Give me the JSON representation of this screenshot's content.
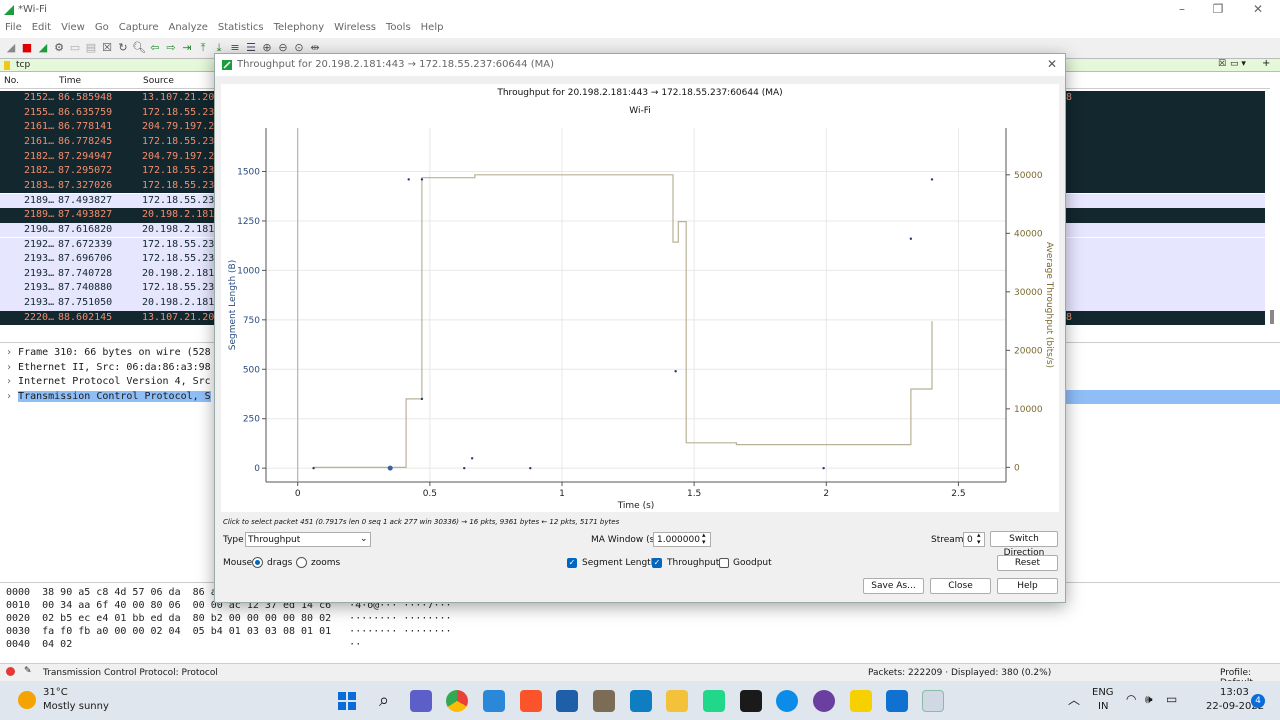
{
  "app": {
    "title": "*Wi-Fi"
  },
  "menu": [
    "File",
    "Edit",
    "View",
    "Go",
    "Capture",
    "Analyze",
    "Statistics",
    "Telephony",
    "Wireless",
    "Tools",
    "Help"
  ],
  "filter": {
    "value": "tcp"
  },
  "packet_list": {
    "headers": {
      "no": "No.",
      "time": "Time",
      "source": "Source"
    },
    "rows": [
      {
        "no": "2152…",
        "time": "86.585948",
        "source": "13.107.21.20",
        "style": "dark"
      },
      {
        "no": "2155…",
        "time": "86.635759",
        "source": "172.18.55.23",
        "style": "dark"
      },
      {
        "no": "2161…",
        "time": "86.778141",
        "source": "204.79.197.2",
        "style": "dark"
      },
      {
        "no": "2161…",
        "time": "86.778245",
        "source": "172.18.55.23",
        "style": "dark"
      },
      {
        "no": "2182…",
        "time": "87.294947",
        "source": "204.79.197.2",
        "style": "dark"
      },
      {
        "no": "2182…",
        "time": "87.295072",
        "source": "172.18.55.23",
        "style": "dark"
      },
      {
        "no": "2183…",
        "time": "87.327026",
        "source": "172.18.55.23",
        "style": "dark"
      },
      {
        "no": "2189…",
        "time": "87.493827",
        "source": "172.18.55.23",
        "style": "light"
      },
      {
        "no": "2189…",
        "time": "87.493827",
        "source": "20.198.2.181",
        "style": "dark"
      },
      {
        "no": "2190…",
        "time": "87.616820",
        "source": "20.198.2.181",
        "style": "light"
      },
      {
        "no": "2192…",
        "time": "87.672339",
        "source": "172.18.55.23",
        "style": "light"
      },
      {
        "no": "2193…",
        "time": "87.696706",
        "source": "172.18.55.23",
        "style": "light"
      },
      {
        "no": "2193…",
        "time": "87.740728",
        "source": "20.198.2.181",
        "style": "light"
      },
      {
        "no": "2193…",
        "time": "87.740880",
        "source": "172.18.55.23",
        "style": "light"
      },
      {
        "no": "2193…",
        "time": "87.751050",
        "source": "20.198.2.181",
        "style": "light"
      },
      {
        "no": "2220…",
        "time": "88.602145",
        "source": "13.107.21.20",
        "style": "dark"
      }
    ],
    "right_marks": [
      "8",
      "8"
    ]
  },
  "details": [
    "Frame 310: 66 bytes on wire (528",
    "Ethernet II, Src: 06:da:86:a3:98",
    "Internet Protocol Version 4, Src",
    "Transmission Control Protocol, S"
  ],
  "hex": [
    "0000  38 90 a5 c8 4d 57 06 da  86 a",
    "0010  00 34 aa 6f 40 00 80 06  00 00 ac 12 37 ed 14 c6   ·4·o@··· ····7···",
    "0020  02 b5 ec e4 01 bb ed da  80 b2 00 00 00 00 80 02   ········ ········",
    "0030  fa f0 fb a0 00 00 02 04  05 b4 01 03 03 08 01 01   ········ ········",
    "0040  04 02                                              ··"
  ],
  "status": {
    "left": "Transmission Control Protocol: Protocol",
    "packets": "Packets: 222209 · Displayed: 380 (0.2%)",
    "profile": "Profile: Default"
  },
  "dialog": {
    "window_title": "Throughput for 20.198.2.181:443 → 172.18.55.237:60644 (MA)",
    "click_hint": "Click to select packet 451 (0.7917s len 0 seq 1 ack 277 win 30336) → 16 pkts, 9361 bytes ← 12 pkts, 5171 bytes",
    "type_label": "Type",
    "type_value": "Throughput",
    "ma_label": "MA Window (s)",
    "ma_value": "1.000000",
    "stream_label": "Stream",
    "stream_value": "0",
    "switch_direction": "Switch Direction",
    "mouse_label": "Mouse",
    "drags": "drags",
    "zooms": "zooms",
    "seg_len": "Segment Length",
    "throughput": "Throughput",
    "goodput": "Goodput",
    "reset": "Reset",
    "save_as": "Save As...",
    "close": "Close",
    "help": "Help"
  },
  "chart_data": {
    "type": "scatter",
    "title": "Throughput for 20.198.2.181:443 → 172.18.55.237:60644 (MA)",
    "subtitle": "Wi-Fi",
    "xlabel": "Time (s)",
    "ylabel": "Segment Length (B)",
    "y2label": "Average Throughput (bits/s)",
    "xlim": [
      -0.12,
      2.68
    ],
    "ylim": [
      -70,
      1720
    ],
    "y2lim": [
      -2500,
      58000
    ],
    "xticks": [
      0,
      0.5,
      1,
      1.5,
      2,
      2.5
    ],
    "yticks": [
      0,
      250,
      500,
      750,
      1000,
      1250,
      1500
    ],
    "y2ticks": [
      0,
      10000,
      20000,
      30000,
      40000,
      50000
    ],
    "grid": true,
    "series": [
      {
        "name": "Segment Length",
        "color": "#1f3b6e",
        "points": [
          [
            0.06,
            0
          ],
          [
            0.35,
            0
          ],
          [
            0.42,
            1460
          ],
          [
            0.47,
            1460
          ],
          [
            0.47,
            350
          ],
          [
            0.63,
            0
          ],
          [
            0.66,
            50
          ],
          [
            0.88,
            0
          ],
          [
            1.43,
            490
          ],
          [
            1.99,
            0
          ],
          [
            2.32,
            1160
          ],
          [
            2.4,
            1460
          ]
        ]
      },
      {
        "name": "Throughput",
        "color": "#b8b296",
        "points": [
          [
            0.06,
            0
          ],
          [
            0.41,
            0
          ],
          [
            0.41,
            11700
          ],
          [
            0.47,
            11700
          ],
          [
            0.47,
            49500
          ],
          [
            0.67,
            49500
          ],
          [
            0.67,
            50000
          ],
          [
            1.42,
            50000
          ],
          [
            1.42,
            38500
          ],
          [
            1.44,
            38500
          ],
          [
            1.44,
            42000
          ],
          [
            1.47,
            42000
          ],
          [
            1.47,
            4200
          ],
          [
            1.66,
            4200
          ],
          [
            1.66,
            3900
          ],
          [
            2.32,
            3900
          ],
          [
            2.32,
            13400
          ],
          [
            2.4,
            13400
          ],
          [
            2.4,
            25000
          ]
        ]
      }
    ]
  },
  "taskbar": {
    "weather_temp": "31°C",
    "weather_desc": "Mostly sunny",
    "lang": "ENG",
    "region": "IN",
    "time": "13:03",
    "date": "22-09-2022",
    "badge": "4"
  }
}
